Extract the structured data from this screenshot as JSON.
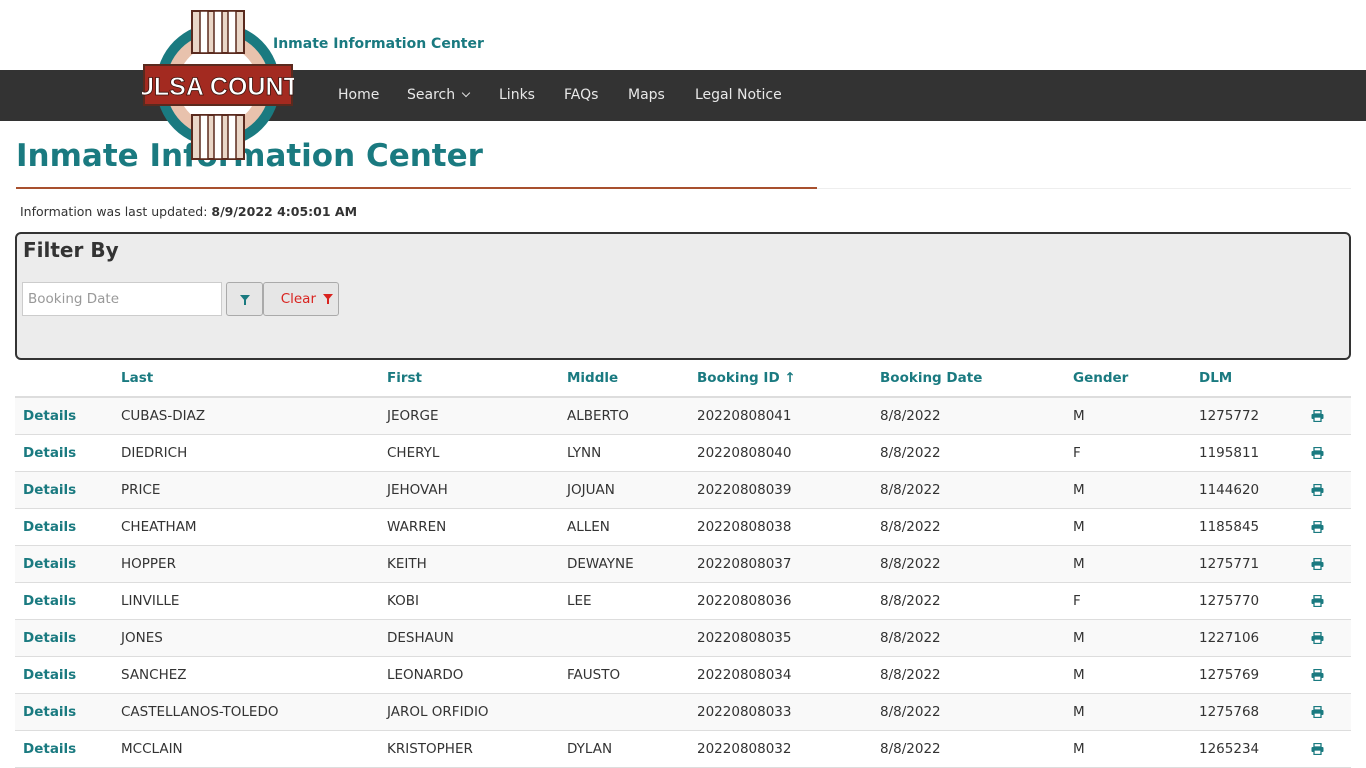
{
  "header": {
    "site_title": "Inmate Information Center",
    "logo_text": "TULSA COUNTY"
  },
  "nav": {
    "items": [
      {
        "label": "Home"
      },
      {
        "label": "Search",
        "has_dropdown": true
      },
      {
        "label": "Links"
      },
      {
        "label": "FAQs"
      },
      {
        "label": "Maps"
      },
      {
        "label": "Legal Notice"
      }
    ]
  },
  "page": {
    "title": "Inmate Information Center",
    "updated_label": "Information was last updated:",
    "updated_value": "8/9/2022 4:05:01 AM"
  },
  "filter": {
    "title": "Filter By",
    "booking_date_placeholder": "Booking Date",
    "booking_date_value": "",
    "filter_button_icon": "filter-icon",
    "clear_label": "Clear"
  },
  "table": {
    "columns": [
      "",
      "Last",
      "First",
      "Middle",
      "Booking ID ↑",
      "Booking Date",
      "Gender",
      "DLM",
      ""
    ],
    "rows": [
      {
        "details": "Details",
        "last": "CUBAS-DIAZ",
        "first": "JEORGE",
        "middle": "ALBERTO",
        "booking_id": "20220808041",
        "booking_date": "8/8/2022",
        "gender": "M",
        "dlm": "1275772"
      },
      {
        "details": "Details",
        "last": "DIEDRICH",
        "first": "CHERYL",
        "middle": "LYNN",
        "booking_id": "20220808040",
        "booking_date": "8/8/2022",
        "gender": "F",
        "dlm": "1195811"
      },
      {
        "details": "Details",
        "last": "PRICE",
        "first": "JEHOVAH",
        "middle": "JOJUAN",
        "booking_id": "20220808039",
        "booking_date": "8/8/2022",
        "gender": "M",
        "dlm": "1144620"
      },
      {
        "details": "Details",
        "last": "CHEATHAM",
        "first": "WARREN",
        "middle": "ALLEN",
        "booking_id": "20220808038",
        "booking_date": "8/8/2022",
        "gender": "M",
        "dlm": "1185845"
      },
      {
        "details": "Details",
        "last": "HOPPER",
        "first": "KEITH",
        "middle": "DEWAYNE",
        "booking_id": "20220808037",
        "booking_date": "8/8/2022",
        "gender": "M",
        "dlm": "1275771"
      },
      {
        "details": "Details",
        "last": "LINVILLE",
        "first": "KOBI",
        "middle": "LEE",
        "booking_id": "20220808036",
        "booking_date": "8/8/2022",
        "gender": "F",
        "dlm": "1275770"
      },
      {
        "details": "Details",
        "last": "JONES",
        "first": "DESHAUN",
        "middle": "",
        "booking_id": "20220808035",
        "booking_date": "8/8/2022",
        "gender": "M",
        "dlm": "1227106"
      },
      {
        "details": "Details",
        "last": "SANCHEZ",
        "first": "LEONARDO",
        "middle": "FAUSTO",
        "booking_id": "20220808034",
        "booking_date": "8/8/2022",
        "gender": "M",
        "dlm": "1275769"
      },
      {
        "details": "Details",
        "last": "CASTELLANOS-TOLEDO",
        "first": "JAROL ORFIDIO",
        "middle": "",
        "booking_id": "20220808033",
        "booking_date": "8/8/2022",
        "gender": "M",
        "dlm": "1275768"
      },
      {
        "details": "Details",
        "last": "MCCLAIN",
        "first": "KRISTOPHER",
        "middle": "DYLAN",
        "booking_id": "20220808032",
        "booking_date": "8/8/2022",
        "gender": "M",
        "dlm": "1265234"
      }
    ],
    "row_action_icon": "print-icon"
  },
  "colors": {
    "accent": "#1a7a80",
    "nav_bg": "#333333",
    "rule": "#a8502e",
    "clear": "#d9231f"
  }
}
